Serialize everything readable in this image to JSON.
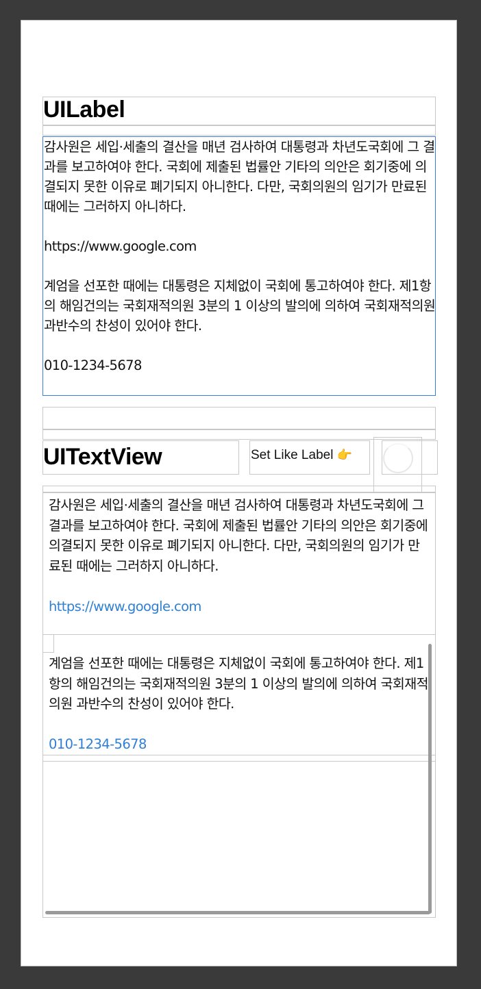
{
  "label_section": {
    "title": "UILabel",
    "paragraph1": "감사원은 세입·세출의 결산을 매년 검사하여 대통령과 차년도국회에 그 결과를 보고하여야 한다. 국회에 제출된 법률안 기타의 의안은 회기중에 의결되지 못한 이유로 폐기되지 아니한다. 다만, 국회의원의 임기가 만료된 때에는 그러하지 아니하다.",
    "url": "https://www.google.com",
    "paragraph2": "계엄을 선포한 때에는 대통령은 지체없이 국회에 통고하여야 한다. 제1항의 해임건의는 국회재적의원 3분의 1 이상의 발의에 의하여 국회재적의원 과반수의 찬성이 있어야 한다.",
    "phone": "010-1234-5678"
  },
  "textview_section": {
    "title": "UITextView",
    "set_like_label_button": "Set Like Label",
    "button_emoji": "👉",
    "paragraph1": "감사원은 세입·세출의 결산을 매년 검사하여 대통령과 차년도국회에 그 결과를 보고하여야 한다. 국회에 제출된 법률안 기타의 의안은 회기중에 의결되지 못한 이유로 폐기되지 아니한다. 다만, 국회의원의 임기가 만료된 때에는 그러하지 아니하다.",
    "url": "https://www.google.com",
    "paragraph2": "계엄을 선포한 때에는 대통령은 지체없이 국회에 통고하여야 한다. 제1항의 해임건의는 국회재적의원 3분의 1 이상의 발의에 의하여 국회재적의원 과반수의 찬성이 있어야 한다.",
    "phone": "010-1234-5678"
  },
  "colors": {
    "link": "#2f7fd4",
    "label_border_selected": "#3c7be0",
    "outline": "#c8c8c8"
  },
  "icons": [
    "pointing-right-emoji",
    "activity-spinner"
  ]
}
